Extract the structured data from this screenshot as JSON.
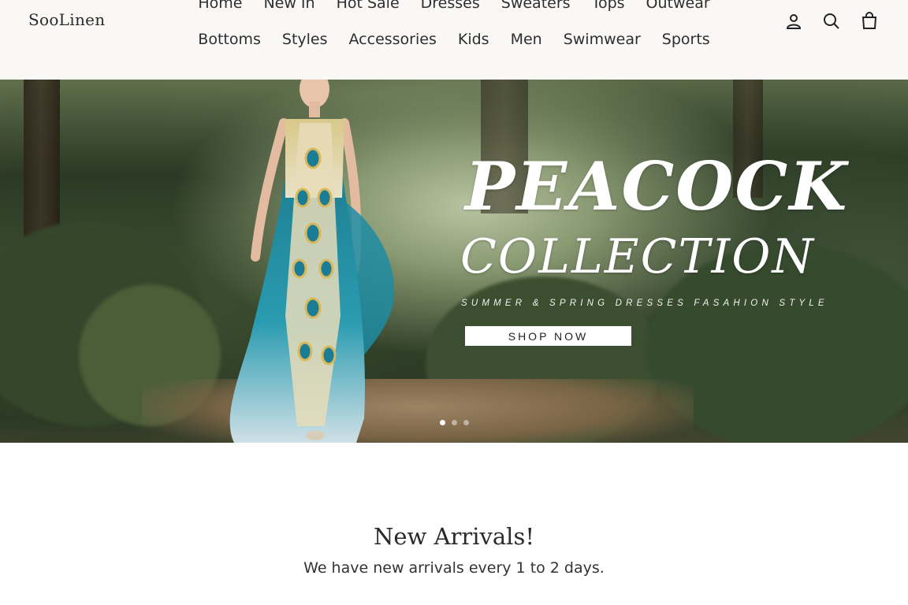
{
  "header": {
    "logo": "SooLinen",
    "nav_row1": [
      "Home",
      "New In",
      "Hot Sale",
      "Dresses",
      "Sweaters",
      "Tops",
      "Outwear"
    ],
    "nav_row2": [
      "Bottoms",
      "Styles",
      "Accessories",
      "Kids",
      "Men",
      "Swimwear",
      "Sports"
    ],
    "icons": [
      "account-icon",
      "search-icon",
      "cart-icon"
    ]
  },
  "hero": {
    "title": "PEACOCK",
    "subtitle": "COLLECTION",
    "tagline": "SUMMER & SPRING DRESSES FASAHION STYLE",
    "button": "SHOP NOW",
    "slides_total": 3,
    "active_slide": 1
  },
  "arrivals": {
    "title": "New Arrivals!",
    "subtitle": "We have new arrivals every 1 to 2 days."
  },
  "colors": {
    "header_bg": "#f9f8f6",
    "dress_teal": "#1f8fa3",
    "text_dark": "#2a2a2a"
  }
}
